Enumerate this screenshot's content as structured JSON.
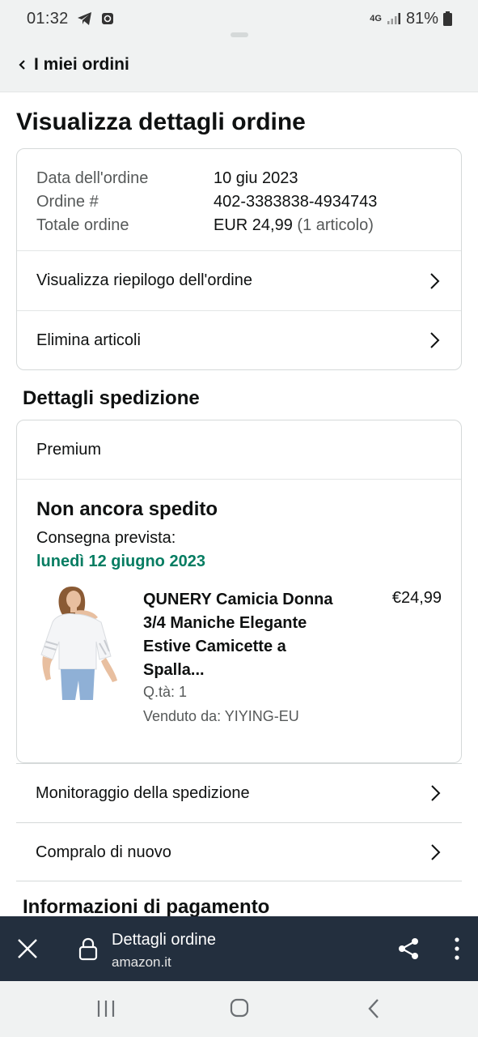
{
  "status_bar": {
    "time": "01:32",
    "network": "4G",
    "battery": "81%"
  },
  "header": {
    "back_label": "I miei ordini"
  },
  "page": {
    "title": "Visualizza dettagli ordine"
  },
  "order_info": {
    "rows": [
      {
        "label": "Data dell'ordine",
        "value": "10 giu 2023"
      },
      {
        "label": "Ordine #",
        "value": "402-3383838-4934743"
      },
      {
        "label": "Totale ordine",
        "value": "EUR 24,99",
        "extra": "(1 articolo)"
      }
    ],
    "links": [
      "Visualizza riepilogo dell'ordine",
      "Elimina articoli"
    ]
  },
  "shipping": {
    "section_title": "Dettagli spedizione",
    "type": "Premium",
    "status": "Non ancora spedito",
    "delivery_label": "Consegna prevista:",
    "delivery_date": "lunedì 12 giugno 2023",
    "product": {
      "title": "QUNERY Camicia Donna 3/4 Maniche Elegante Estive Camicette a Spalla...",
      "price": "€24,99",
      "quantity": "Q.tà: 1",
      "seller": "Venduto da: YIYING-EU"
    }
  },
  "actions": [
    "Monitoraggio della spedizione",
    "Compralo di nuovo"
  ],
  "payment": {
    "section_title": "Informazioni di pagamento"
  },
  "browser_bar": {
    "title": "Dettagli ordine",
    "domain": "amazon.it"
  },
  "colors": {
    "accent_green": "#067d62",
    "browser_bar": "#232f3e"
  }
}
